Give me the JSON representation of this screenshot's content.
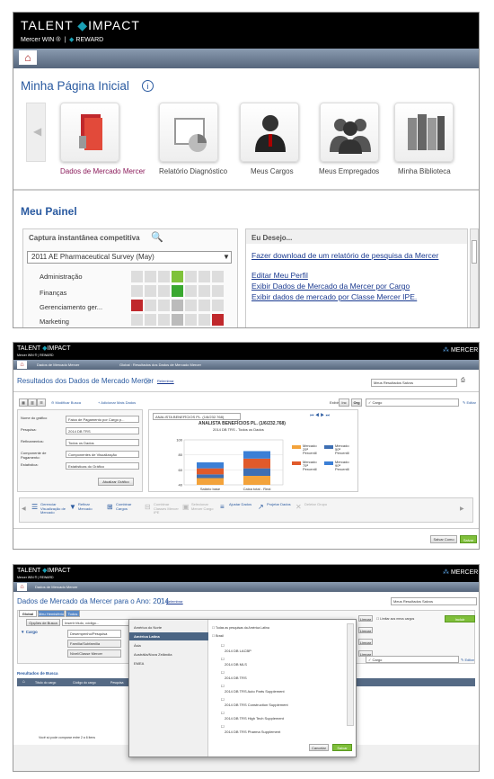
{
  "s1": {
    "brand": "TALENT",
    "brand2": "IMPACT",
    "sub": "Mercer WIN ®",
    "sub2": "REWARD",
    "page_title": "Minha Página Inicial",
    "tiles": [
      "Dados de Mercado Mercer",
      "Relatório Diagnóstico",
      "Meus Cargos",
      "Meus Empregados",
      "Minha Biblioteca"
    ],
    "meu_painel": "Meu Painel",
    "snapshot_title": "Captura instantânea competitiva",
    "survey_select": "2011 AE Pharmaceutical Survey (May)",
    "rows": [
      "Administração",
      "Finanças",
      "Gerenciamento ger...",
      "Marketing"
    ],
    "desejo_title": "Eu Desejo...",
    "desejo_links": [
      "Fazer download de um relatório de pesquisa da Mercer",
      "Editar Meu Perfil",
      "Exibir Dados de Mercado da Mercer por Cargo",
      "Exibir dados de mercado por Classe Mercer IPE."
    ]
  },
  "s2": {
    "brand": "TALENT",
    "brand2": "IMPACT",
    "sub": "Mercer WIN ®",
    "sub2": "REWARD",
    "mercer": "MERCER",
    "crumb1": "Dados de Mercado Mercer",
    "crumb2": "Global : Resultados dos Dados de Mercado Mercer",
    "title": "Resultados dos Dados de Mercado Mercer",
    "title_link": "Relembrar",
    "results_select": "Meus Resultados Salvos",
    "toolbar_a": "Modificar Busca",
    "toolbar_b": "Adicionar Mais Dados",
    "filter_label": "Exibir",
    "filter_btn1": "Inc",
    "filter_btn2": "Org",
    "search_ph": "Cargo",
    "edit": "Editar",
    "form_labels": [
      "Nome do gráfico",
      "Pesquisa:",
      "Refinamentos:",
      "Componente de Pagamento:",
      "Estatística:"
    ],
    "form_values": [
      "Faixa de Pagamento por Cargo p...",
      "2014 DB TRS",
      "Todos os Dados",
      "Componentes de Visualização",
      "Estatísticas do Gráfico"
    ],
    "form_btn": "Atualizar Gráfico",
    "chart_select": "ANALISTA BENEFÍCIOS PL. (1/6/232.768)",
    "legend": [
      "Mercado 25ª Percentil",
      "Mercado 50ª Percentil",
      "Mercado 75ª Percentil",
      "Mercado 90ª Percentil"
    ],
    "actions": [
      "Gerenciar Visualização de Mercado",
      "Refinar Mercado",
      "Combinar Cargos",
      "Combinar Classes Mercer IPE",
      "Selecionar Mercer Cargo",
      "Ajustar Dados",
      "Projetar Dados",
      "Deletar Grupo"
    ],
    "btn_save_as": "Salvar Como",
    "btn_save": "Salvar"
  },
  "chart_data": {
    "type": "bar",
    "title": "ANALISTA BENEFÍCIOS PL. (1/6/232.768)",
    "subtitle": "2014 DB TRS - Todos os Dados",
    "categories": [
      "Salário base",
      "Caixa total - Real"
    ],
    "ylim": [
      40,
      100
    ],
    "yticks": [
      40,
      60,
      80,
      100
    ],
    "series": [
      {
        "name": "Mercado 25ª Percentil",
        "color": "#f3a33b",
        "values": [
          49,
          52
        ]
      },
      {
        "name": "Mercado 50ª Percentil",
        "color": "#3e6fb3",
        "values": [
          54,
          62
        ]
      },
      {
        "name": "Mercado 75ª Percentil",
        "color": "#e05a2a",
        "values": [
          62,
          75
        ]
      },
      {
        "name": "Mercado 90ª Percentil",
        "color": "#3b7fd6",
        "values": [
          70,
          85
        ]
      }
    ]
  },
  "s3": {
    "brand": "TALENT",
    "brand2": "IMPACT",
    "sub": "Mercer WIN ®",
    "sub2": "REWARD",
    "mercer": "MERCER",
    "crumb": "Dados de Mercado Mercer",
    "title": "Dados de Mercado da Mercer para o Ano: 2014",
    "title_link": "Relembrar",
    "results_select": "Meus Resultados Salvos",
    "tabs": [
      "Global",
      "Meu Hemisfério",
      "Todos"
    ],
    "left_btn": "Opções de Busca",
    "left_btn2": "Inserir título, código...",
    "left_label": "Cargo",
    "menu": [
      "Desempenho/Pesquisa",
      "Família/Subfamília",
      "Nível/Classe Mercer"
    ],
    "sec_title": "Resultados de Busca",
    "cols": [
      "Título do cargo",
      "Código do cargo",
      "Pesquisa"
    ],
    "footer": "Você só pode comparar entre 2 a 6 itens",
    "right_btns": [
      "Limpar",
      "Limpar",
      "Limpar",
      "Limpar"
    ],
    "limit_label": "Limitar aos meus cargos",
    "add": "Incluir",
    "search_ph": "Cargo",
    "edit": "Editar",
    "modal_left": [
      "América do Norte",
      "América Latina",
      "Ásia",
      "Austrália/Nova Zelândia",
      "EMEA"
    ],
    "modal_header": "Todas as pesquisas da América Latina",
    "modal_country": "Brasil",
    "modal_items": [
      "2014 DB LACBP",
      "2014 DB MLS",
      "2014 DB TRS",
      "2014 DB TRS Auto Parts Supplement",
      "2014 DB TRS Construction Supplement",
      "2014 DB TRS High Tech Supplement",
      "2014 DB TRS Pharma Supplement"
    ],
    "modal_cancel": "Cancelar",
    "modal_ok": "Salvar"
  }
}
